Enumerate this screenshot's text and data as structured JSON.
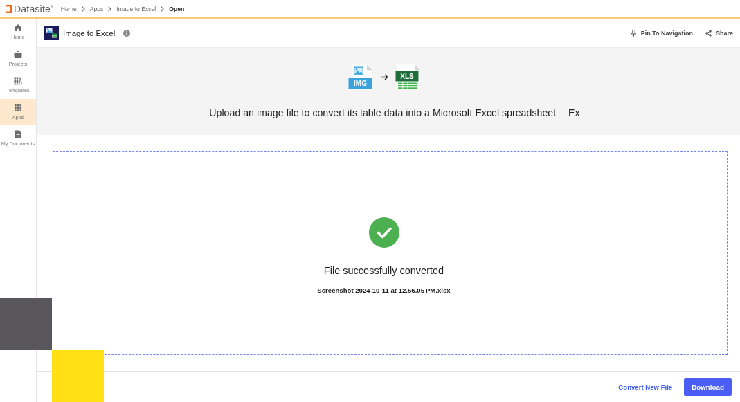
{
  "topbar": {
    "brand": "Datasite$^{®}$",
    "breadcrumbs": [
      {
        "label": "Home",
        "current": false
      },
      {
        "label": "Apps",
        "current": false
      },
      {
        "label": "Image to Excel",
        "current": false
      },
      {
        "label": "Open",
        "current": true
      }
    ]
  },
  "sidebar": {
    "items": [
      {
        "label": "Home",
        "selected": false
      },
      {
        "label": "Projects",
        "selected": false
      },
      {
        "label": "Templates",
        "selected": false
      },
      {
        "label": "Apps",
        "selected": true
      },
      {
        "label": "My Documents",
        "selected": false
      }
    ]
  },
  "header": {
    "title": "Image to Excel",
    "actions": [
      "Pin To Navigation",
      "Share"
    ]
  },
  "hero": {
    "source_badge": "IMG",
    "target_badge": "XLS",
    "heading": "Upload an image file to convert its table data into a Microsoft Excel spreadsheet",
    "heading_repeat": "Ex"
  },
  "result": {
    "message": "File successfully converted",
    "filename": "Screenshot 2024-10-11 at 12.56.05 PM.xlsx"
  },
  "footer": {
    "secondary_action": "Convert New File",
    "primary_action": "Download"
  }
}
